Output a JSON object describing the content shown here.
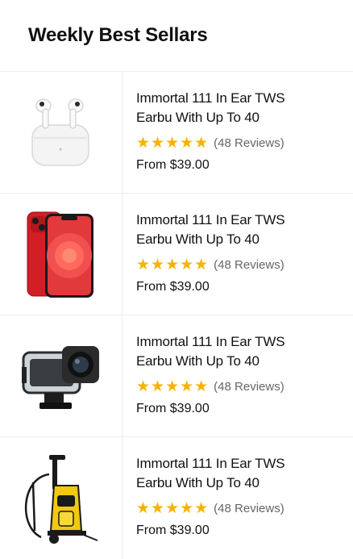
{
  "section": {
    "title": "Weekly Best Sellars"
  },
  "products": [
    {
      "image": "earbuds-image",
      "name": "Immortal 111 In Ear TWS Earbu With Up To 40",
      "stars": "★★★★★",
      "reviews": "(48 Reviews)",
      "price": "From $39.00"
    },
    {
      "image": "smartphone-image",
      "name": "Immortal 111 In Ear TWS Earbu With Up To 40",
      "stars": "★★★★★",
      "reviews": "(48 Reviews)",
      "price": "From $39.00"
    },
    {
      "image": "action-camera-image",
      "name": "Immortal 111 In Ear TWS Earbu With Up To 40",
      "stars": "★★★★★",
      "reviews": "(48 Reviews)",
      "price": "From $39.00"
    },
    {
      "image": "pressure-washer-image",
      "name": "Immortal 111 In Ear TWS Earbu With Up To 40",
      "stars": "★★★★★",
      "reviews": "(48 Reviews)",
      "price": "From $39.00"
    }
  ],
  "colors": {
    "star": "#f5b301",
    "divider": "#ececec",
    "text": "#111111",
    "muted": "#666666"
  }
}
